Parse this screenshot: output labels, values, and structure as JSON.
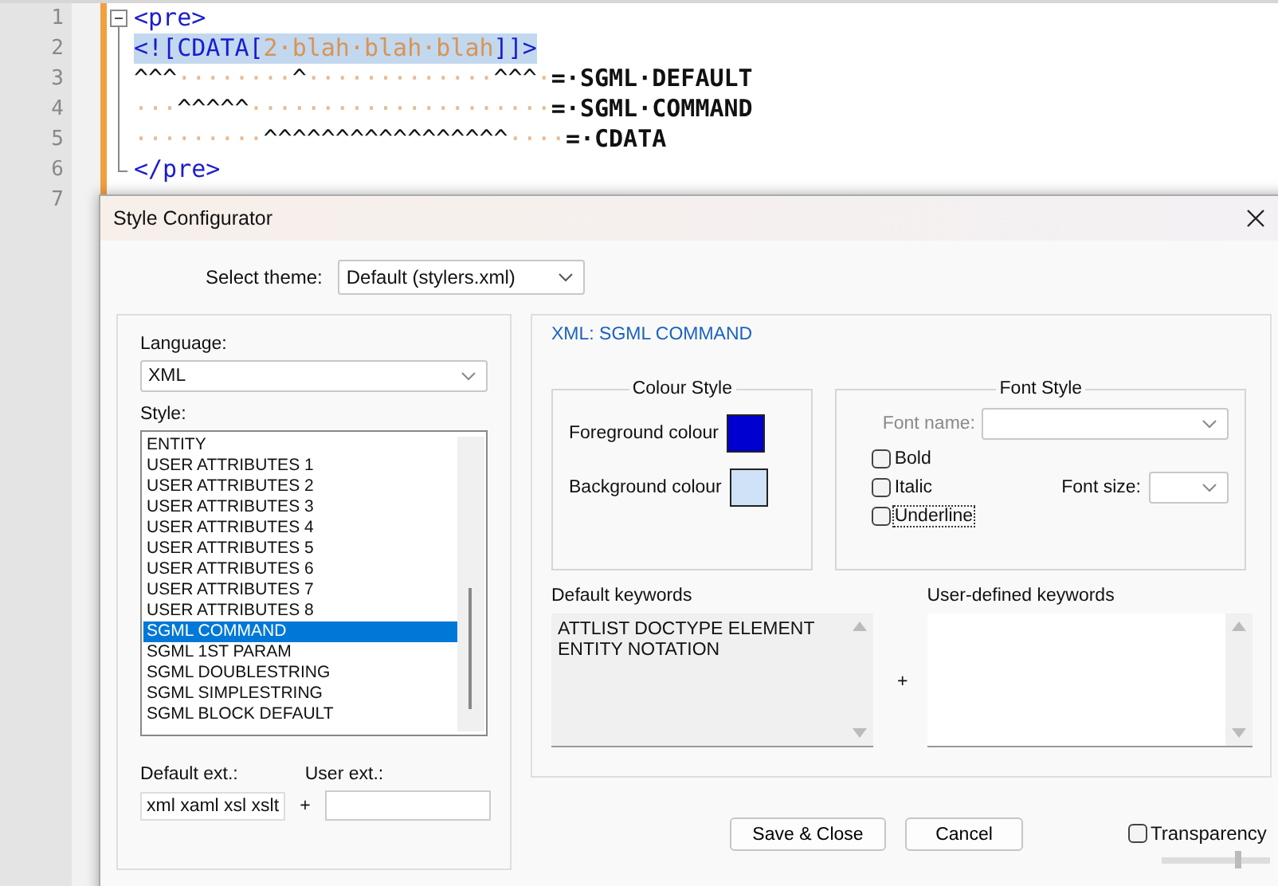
{
  "editor": {
    "lines": [
      {
        "number": "1",
        "kind": "start",
        "segments": [
          {
            "kind": "tag",
            "text": "<pre>",
            "selected": false
          }
        ]
      },
      {
        "number": "2",
        "kind": "body",
        "segments": [
          {
            "kind": "tag",
            "text": "<![CDATA[",
            "selected": true
          },
          {
            "kind": "string",
            "text": "2·blah·blah·blah",
            "selected": true
          },
          {
            "kind": "tag",
            "text": "]]>",
            "selected": true
          }
        ]
      },
      {
        "number": "3",
        "kind": "body",
        "segments": [
          {
            "kind": "caret",
            "text": "^^^",
            "selected": false
          },
          {
            "kind": "space",
            "text": "········",
            "selected": false
          },
          {
            "kind": "caret",
            "text": "^",
            "selected": false
          },
          {
            "kind": "space",
            "text": "·············",
            "selected": false
          },
          {
            "kind": "caret",
            "text": "^^^",
            "selected": false
          },
          {
            "kind": "space",
            "text": "·",
            "selected": false
          },
          {
            "kind": "label",
            "text": "=·SGML·DEFAULT",
            "selected": false
          }
        ]
      },
      {
        "number": "4",
        "kind": "body",
        "segments": [
          {
            "kind": "space",
            "text": "···",
            "selected": false
          },
          {
            "kind": "caret",
            "text": "^^^^^",
            "selected": false
          },
          {
            "kind": "space",
            "text": "·····················",
            "selected": false
          },
          {
            "kind": "label",
            "text": "=·SGML·COMMAND",
            "selected": false
          }
        ]
      },
      {
        "number": "5",
        "kind": "body",
        "segments": [
          {
            "kind": "space",
            "text": "·········",
            "selected": false
          },
          {
            "kind": "caret",
            "text": "^^^^^^^^^^^^^^^^^",
            "selected": false
          },
          {
            "kind": "space",
            "text": "····",
            "selected": false
          },
          {
            "kind": "label",
            "text": "=·CDATA",
            "selected": false
          }
        ]
      },
      {
        "number": "6",
        "kind": "end",
        "segments": [
          {
            "kind": "tag",
            "text": "</pre>",
            "selected": false
          }
        ]
      },
      {
        "number": "7"
      }
    ]
  },
  "dialog": {
    "title": "Style Configurator",
    "theme": {
      "label": "Select theme:",
      "value": "Default (stylers.xml)"
    },
    "language": {
      "label": "Language:",
      "value": "XML"
    },
    "style": {
      "label": "Style:",
      "items": [
        {
          "label": "ENTITY",
          "selected": false
        },
        {
          "label": "USER ATTRIBUTES 1",
          "selected": false
        },
        {
          "label": "USER ATTRIBUTES 2",
          "selected": false
        },
        {
          "label": "USER ATTRIBUTES 3",
          "selected": false
        },
        {
          "label": "USER ATTRIBUTES 4",
          "selected": false
        },
        {
          "label": "USER ATTRIBUTES 5",
          "selected": false
        },
        {
          "label": "USER ATTRIBUTES 6",
          "selected": false
        },
        {
          "label": "USER ATTRIBUTES 7",
          "selected": false
        },
        {
          "label": "USER ATTRIBUTES 8",
          "selected": false
        },
        {
          "label": "SGML COMMAND",
          "selected": true
        },
        {
          "label": "SGML 1ST PARAM",
          "selected": false
        },
        {
          "label": "SGML DOUBLESTRING",
          "selected": false
        },
        {
          "label": "SGML SIMPLESTRING",
          "selected": false
        },
        {
          "label": "SGML BLOCK DEFAULT",
          "selected": false
        }
      ]
    },
    "extensions": {
      "default_label": "Default ext.:",
      "default_value": "xml xaml xsl xslt",
      "plus": "+",
      "user_label": "User ext.:"
    },
    "heading": "XML: SGML COMMAND",
    "colour_style": {
      "title": "Colour Style",
      "swatches": [
        {
          "label": "Foreground colour",
          "color": "#0000d0"
        },
        {
          "label": "Background colour",
          "color": "#cfe2f7"
        }
      ]
    },
    "font_style": {
      "title": "Font Style",
      "font_name": {
        "label": "Font name:",
        "disabled": true
      },
      "font_size": {
        "label": "Font size:"
      },
      "checkboxes": [
        {
          "label": "Bold",
          "checked": false
        },
        {
          "label": "Italic",
          "checked": false
        },
        {
          "label": "Underline",
          "checked": false
        }
      ]
    },
    "keywords": {
      "default_label": "Default keywords",
      "default_text": "ATTLIST DOCTYPE ELEMENT ENTITY NOTATION",
      "plus": "+",
      "user_label": "User-defined keywords"
    },
    "buttons": [
      "Save & Close",
      "Cancel"
    ],
    "transparency": {
      "label": "Transparency",
      "checked": false,
      "level": 0.7
    }
  }
}
